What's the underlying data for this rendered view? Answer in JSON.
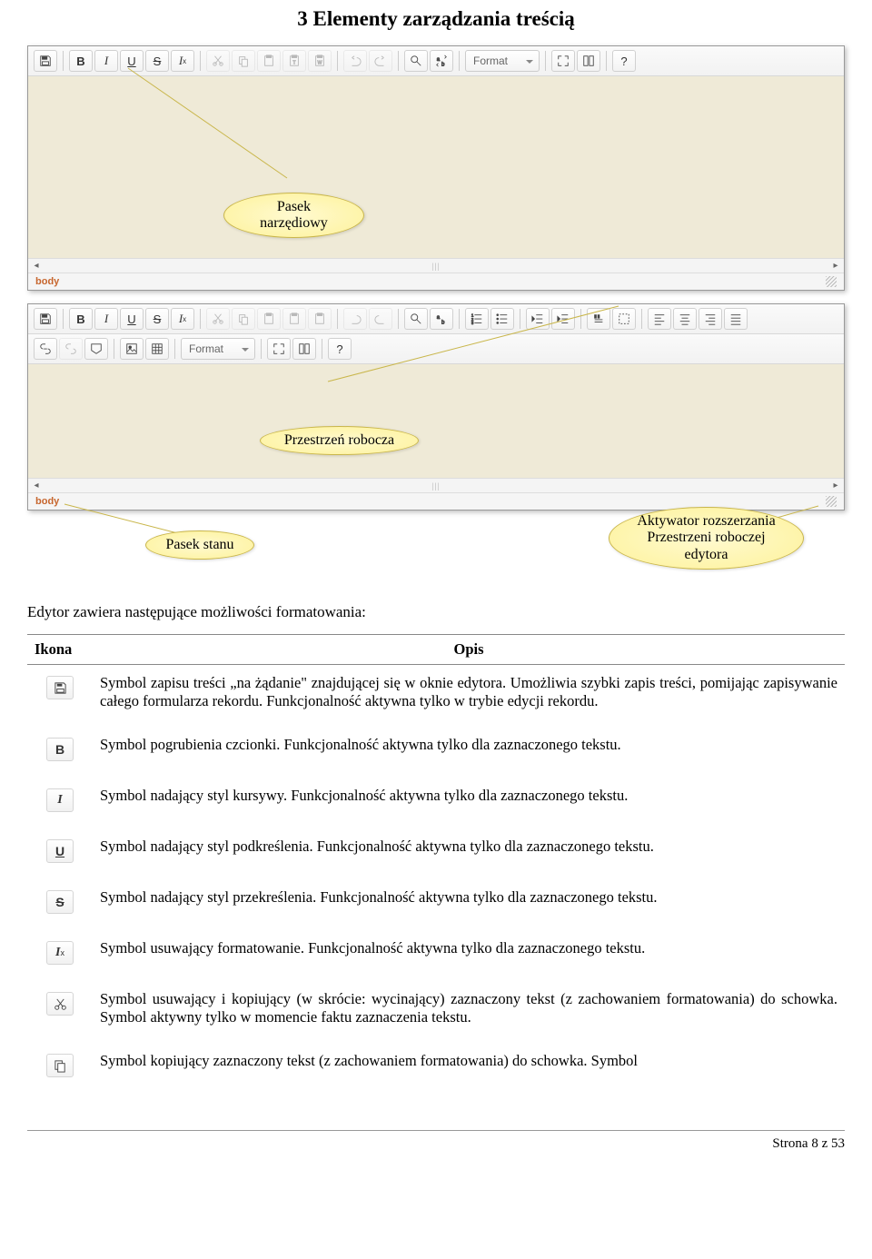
{
  "doc": {
    "title": "3 Elementy zarządzania treścią",
    "intro": "Edytor zawiera następujące możliwości formatowania:",
    "footer": "Strona 8 z 53"
  },
  "editor1": {
    "format_label": "Format",
    "status_path": "body"
  },
  "editor2": {
    "format_label": "Format",
    "status_path": "body"
  },
  "callouts": {
    "toolbar": "Pasek narzędiowy",
    "workspace": "Przestrzeń robocza",
    "statusbar": "Pasek stanu",
    "expander_line1": "Aktywator rozszerzania",
    "expander_line2": "Przestrzeni roboczej",
    "expander_line3": "edytora"
  },
  "table": {
    "headers": {
      "icon": "Ikona",
      "desc": "Opis"
    },
    "rows": [
      {
        "icon": "save",
        "desc": "Symbol zapisu treści „na żądanie\" znajdującej się w oknie edytora. Umożliwia szybki zapis treści, pomijając zapisywanie całego formularza rekordu. Funkcjonalność aktywna tylko w trybie edycji rekordu."
      },
      {
        "icon": "bold",
        "desc": "Symbol pogrubienia czcionki. Funkcjonalność aktywna tylko dla zaznaczonego tekstu."
      },
      {
        "icon": "italic",
        "desc": "Symbol nadający styl kursywy. Funkcjonalność aktywna tylko dla zaznaczonego tekstu."
      },
      {
        "icon": "underline",
        "desc": "Symbol nadający styl podkreślenia. Funkcjonalność aktywna tylko dla zaznaczonego tekstu."
      },
      {
        "icon": "strike",
        "desc": "Symbol nadający styl przekreślenia. Funkcjonalność aktywna tylko dla zaznaczonego tekstu."
      },
      {
        "icon": "removeformat",
        "desc": "Symbol usuwający formatowanie. Funkcjonalność aktywna tylko dla zaznaczonego tekstu."
      },
      {
        "icon": "cut",
        "desc": "Symbol usuwający i kopiujący (w skrócie: wycinający) zaznaczony tekst (z zachowaniem formatowania)  do schowka. Symbol aktywny tylko w momencie faktu zaznaczenia tekstu."
      },
      {
        "icon": "copy",
        "desc": "Symbol kopiujący zaznaczony tekst (z zachowaniem formatowania)  do schowka. Symbol"
      }
    ]
  },
  "icons": {
    "save": "save-icon",
    "bold": "B",
    "italic": "I",
    "underline": "U",
    "strike": "S",
    "removeformat": "Iₓ",
    "cut": "cut-icon",
    "copy": "copy-icon"
  }
}
